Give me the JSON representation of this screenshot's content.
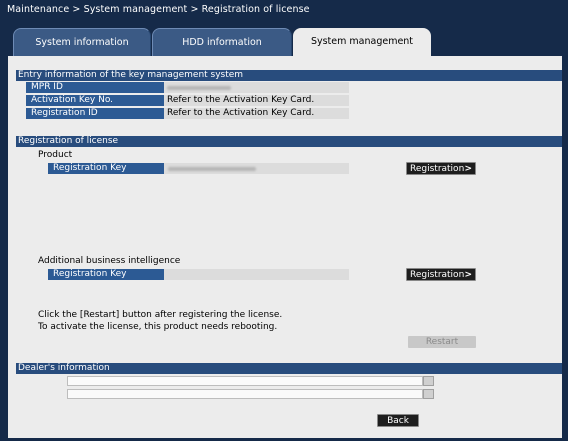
{
  "breadcrumb": "Maintenance > System management > Registration of license",
  "tabs": [
    {
      "label": "System information"
    },
    {
      "label": "HDD information"
    },
    {
      "label": "System management"
    }
  ],
  "entry_section": {
    "title": "Entry information of the key management system",
    "rows": [
      {
        "label": "MPR ID",
        "value": ""
      },
      {
        "label": "Activation Key No.",
        "value": "Refer to the Activation Key Card."
      },
      {
        "label": "Registration ID",
        "value": "Refer to the Activation Key Card."
      }
    ]
  },
  "license_section": {
    "title": "Registration of license",
    "product_label": "Product",
    "product_key_label": "Registration Key",
    "product_register_button": "Registration",
    "abi_label": "Additional business intelligence",
    "abi_key_label": "Registration Key",
    "abi_register_button": "Registration",
    "note_line1": "Click the [Restart] button after registering the license.",
    "note_line2": "To activate the license, this product needs rebooting.",
    "restart_button": "Restart"
  },
  "dealer_section": {
    "title": "Dealer's information"
  },
  "back_button": "Back"
}
